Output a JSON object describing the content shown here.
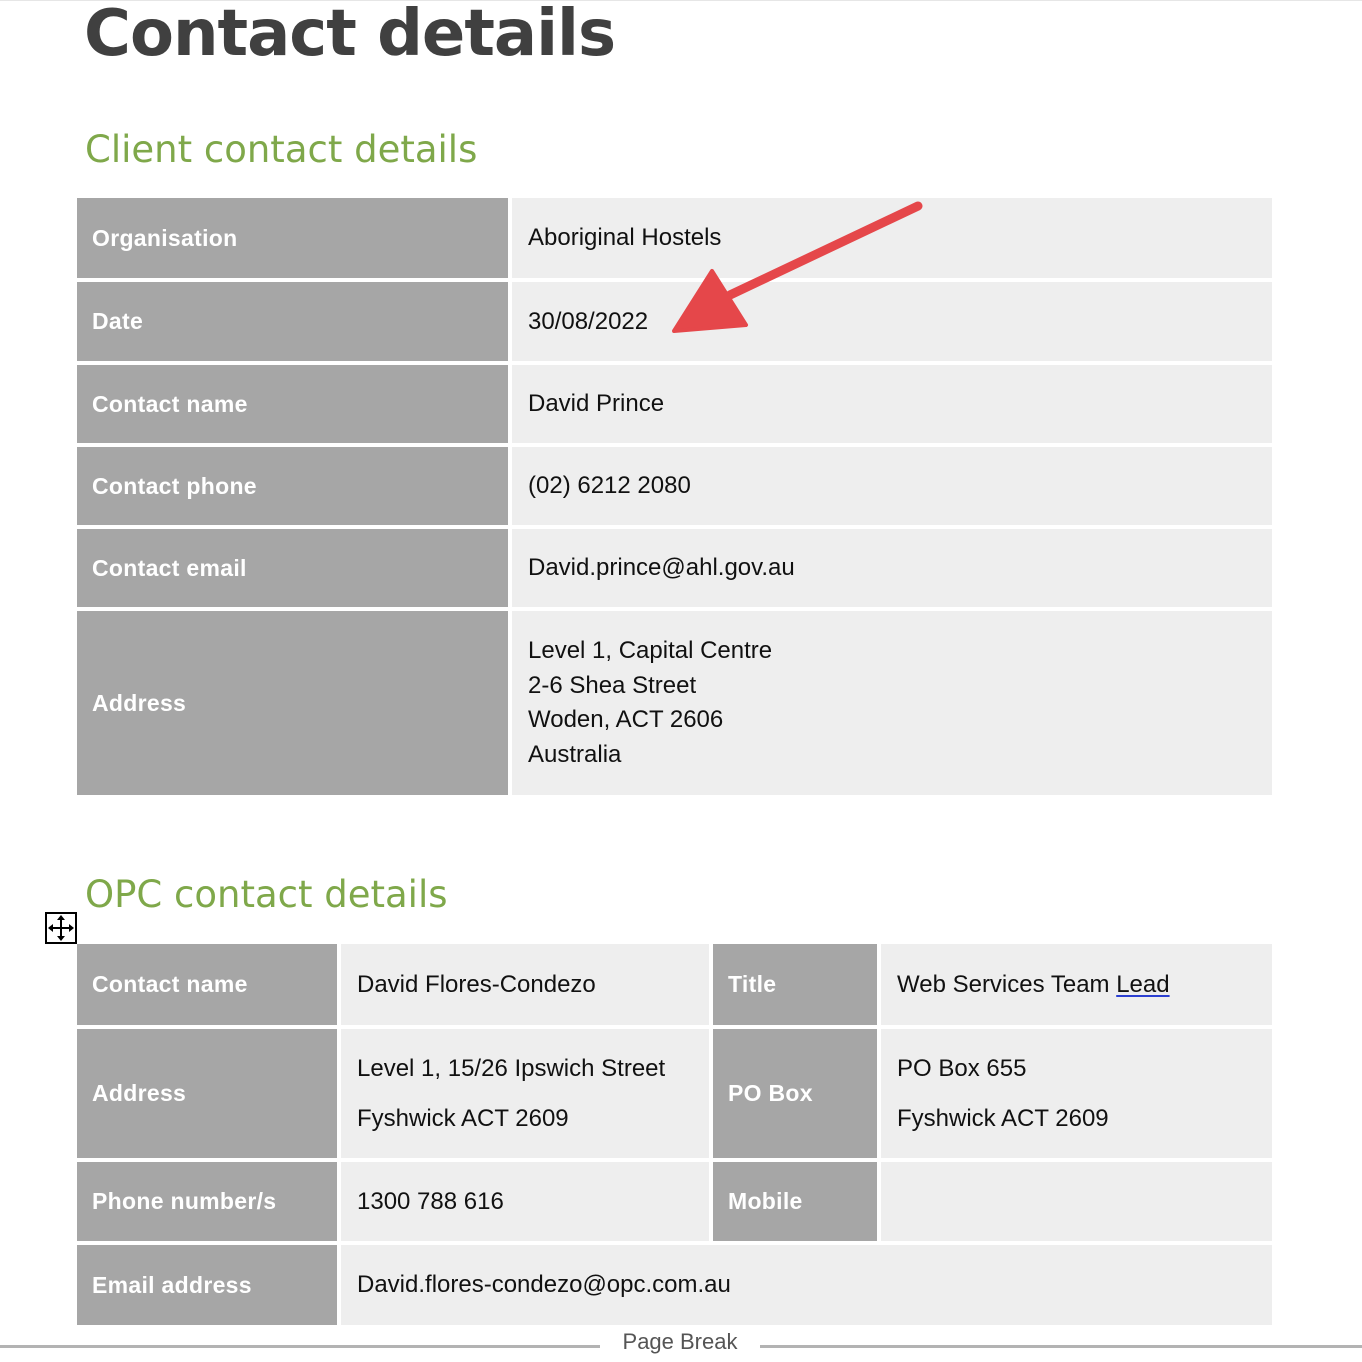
{
  "page_title": "Contact details",
  "client_section": {
    "heading": "Client contact details",
    "rows": [
      {
        "label": "Organisation",
        "value": "Aboriginal Hostels"
      },
      {
        "label": "Date",
        "value": "30/08/2022"
      },
      {
        "label": "Contact name",
        "value": "David Prince"
      },
      {
        "label": "Contact phone",
        "value": "(02) 6212 2080"
      },
      {
        "label": "Contact email",
        "value": "David.prince@ahl.gov.au"
      }
    ],
    "address": {
      "label": "Address",
      "lines": [
        "Level 1, Capital Centre",
        "2-6 Shea Street",
        "Woden, ACT 2606",
        "Australia"
      ]
    }
  },
  "opc_section": {
    "heading": "OPC contact details",
    "contact_name": {
      "label": "Contact name",
      "value": "David Flores-Condezo"
    },
    "title": {
      "label": "Title",
      "value_prefix": "Web Services Team ",
      "value_underlined": "Lead"
    },
    "address": {
      "label": "Address",
      "lines": [
        "Level 1, 15/26 Ipswich Street",
        "Fyshwick ACT 2609"
      ]
    },
    "po_box": {
      "label": "PO Box",
      "lines": [
        "PO Box 655",
        "Fyshwick ACT 2609"
      ]
    },
    "phone": {
      "label": "Phone number/s",
      "value": "1300 788 616"
    },
    "mobile": {
      "label": "Mobile",
      "value": ""
    },
    "email": {
      "label": "Email address",
      "value": "David.flores-condezo@opc.com.au"
    }
  },
  "page_break_label": "Page Break",
  "colors": {
    "heading_green": "#7fa84a",
    "label_cell_gray": "#a6a6a6",
    "value_cell_gray": "#eeeeee",
    "arrow_red": "#e5474a",
    "title_text": "#404040"
  },
  "icons": {
    "annotation": "red-arrow-icon",
    "table_handle": "move-arrows-icon"
  }
}
